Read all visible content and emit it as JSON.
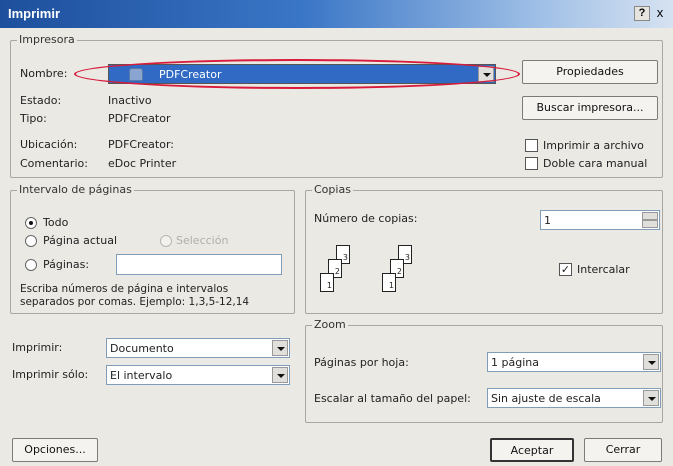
{
  "window": {
    "title": "Imprimir",
    "help": "?",
    "close": "x"
  },
  "printer": {
    "legend": "Impresora",
    "name_label": "Nombre:",
    "name_value": "PDFCreator",
    "status_label": "Estado:",
    "status_value": "Inactivo",
    "type_label": "Tipo:",
    "type_value": "PDFCreator",
    "location_label": "Ubicación:",
    "location_value": "PDFCreator:",
    "comment_label": "Comentario:",
    "comment_value": "eDoc Printer",
    "properties_button": "Propiedades",
    "find_button": "Buscar impresora...",
    "print_to_file": "Imprimir a archivo",
    "manual_duplex": "Doble cara manual"
  },
  "page_range": {
    "legend": "Intervalo de páginas",
    "all": "Todo",
    "current_page": "Página actual",
    "selection": "Selección",
    "pages": "Páginas:",
    "pages_value": "",
    "hint_line1": "Escriba números de página e intervalos",
    "hint_line2": "separados por comas. Ejemplo: 1,3,5-12,14"
  },
  "copies": {
    "legend": "Copias",
    "count_label": "Número de copias:",
    "count_value": "1",
    "collate": "Intercalar",
    "collate_checked": true,
    "page_numbers": [
      "1",
      "2",
      "3"
    ]
  },
  "print_what": {
    "print_label": "Imprimir:",
    "print_value": "Documento",
    "print_only_label": "Imprimir sólo:",
    "print_only_value": "El intervalo"
  },
  "zoom": {
    "legend": "Zoom",
    "pages_per_sheet_label": "Páginas por hoja:",
    "pages_per_sheet_value": "1 página",
    "scale_label": "Escalar al tamaño del papel:",
    "scale_value": "Sin ajuste de escala"
  },
  "footer": {
    "options_button": "Opciones...",
    "ok_button": "Aceptar",
    "cancel_button": "Cerrar"
  },
  "colors": {
    "title_bar": "#1d4f9c",
    "selection": "#316ac5",
    "highlight_ellipse": "#d81b3a"
  }
}
